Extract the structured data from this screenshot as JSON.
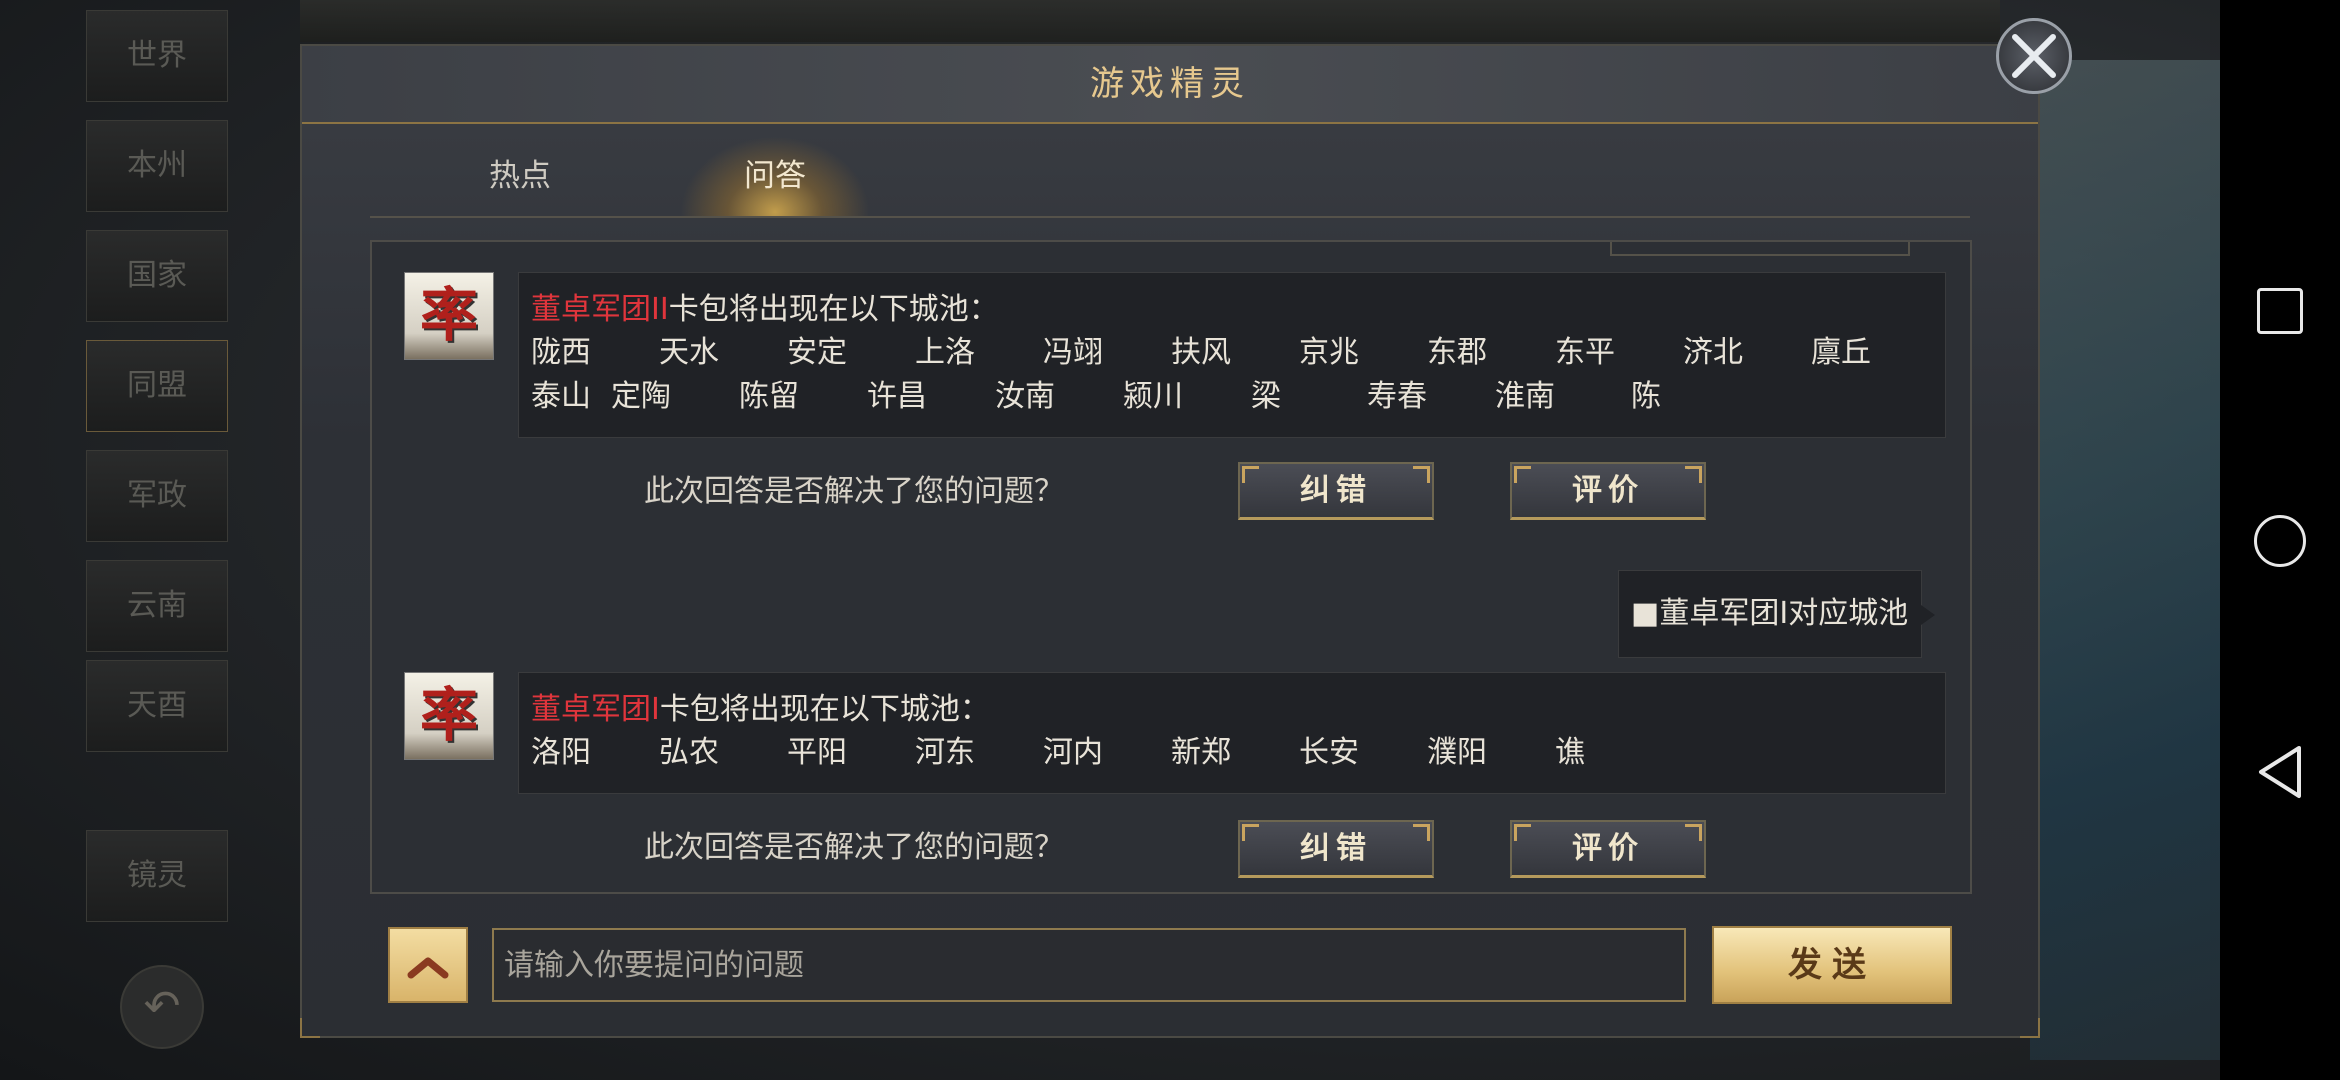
{
  "background": {
    "side_tabs": [
      "世界",
      "本州",
      "国家",
      "同盟",
      "军政",
      "云南",
      "天酉",
      "镜灵"
    ]
  },
  "dialog": {
    "title": "游戏精灵",
    "tabs": [
      {
        "label": "热点",
        "selected": false
      },
      {
        "label": "问答",
        "selected": true
      }
    ]
  },
  "conversation": {
    "answers": [
      {
        "avatar_glyph": "率",
        "highlight": "董卓军团II",
        "suffix": "卡包将出现在以下城池：",
        "cities_row1": [
          "陇西",
          "天水",
          "安定",
          "上洛",
          "冯翊",
          "扶风",
          "京兆",
          "东郡",
          "东平",
          "济北",
          "廪丘"
        ],
        "cities_row2": [
          "泰山",
          "定陶",
          "陈留",
          "许昌",
          "汝南",
          "颍川",
          "梁",
          "寿春",
          "淮南",
          "陈"
        ],
        "feedback_prompt": "此次回答是否解决了您的问题？",
        "correct_label": "纠错",
        "rate_label": "评价"
      },
      {
        "avatar_glyph": "率",
        "highlight": "董卓军团I",
        "suffix": "卡包将出现在以下城池：",
        "cities_row1": [
          "洛阳",
          "弘农",
          "平阳",
          "河东",
          "河内",
          "新郑",
          "长安",
          "濮阳",
          "谯"
        ],
        "feedback_prompt": "此次回答是否解决了您的问题？",
        "correct_label": "纠错",
        "rate_label": "评价"
      }
    ],
    "user_question": "■董卓军团I对应城池"
  },
  "input_bar": {
    "placeholder": "请输入你要提问的问题",
    "send_label": "发送"
  },
  "colors": {
    "highlight_red": "#e0353c",
    "gold": "#e6c88e"
  },
  "icons": [
    "close-icon",
    "chevron-up-icon",
    "square-icon",
    "circle-icon",
    "back-triangle-icon"
  ]
}
